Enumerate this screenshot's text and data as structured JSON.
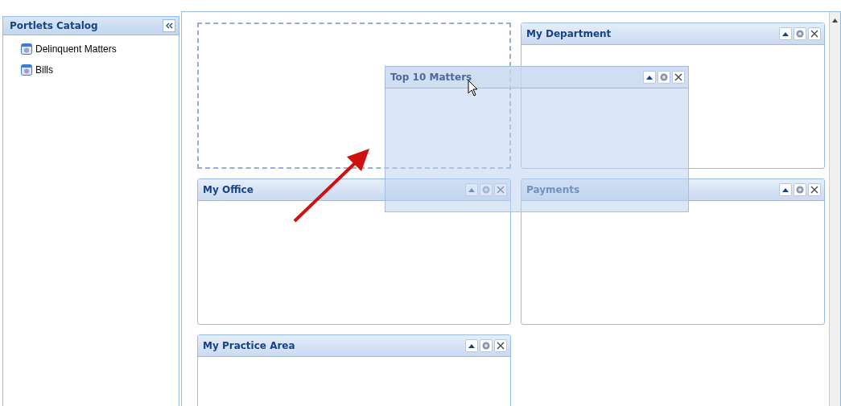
{
  "sidebar": {
    "title": "Portlets Catalog",
    "items": [
      {
        "label": "Delinquent Matters"
      },
      {
        "label": "Bills"
      }
    ]
  },
  "portlets": [
    {
      "kind": "placeholder"
    },
    {
      "kind": "portlet",
      "title": "My Department"
    },
    {
      "kind": "portlet",
      "title": "My Office"
    },
    {
      "kind": "portlet",
      "title": "Payments"
    },
    {
      "kind": "portlet",
      "title": "My Practice Area"
    }
  ],
  "dragged": {
    "title": "Top 10 Matters"
  }
}
